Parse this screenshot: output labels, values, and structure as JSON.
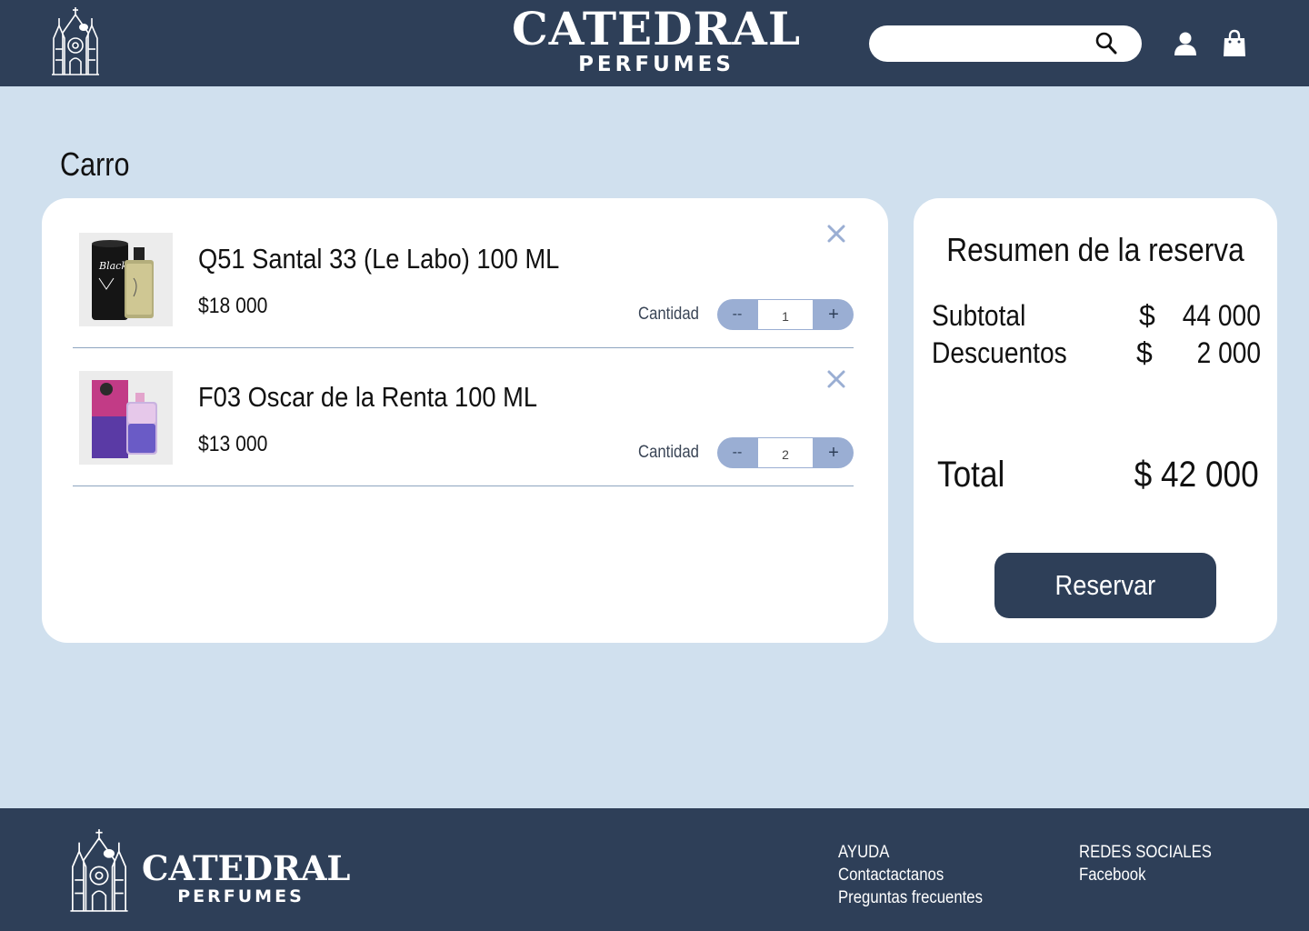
{
  "header": {
    "brand_main": "CATEDRAL",
    "brand_sub": "PERFUMES",
    "search_placeholder": "",
    "icons": [
      "cathedral-logo-icon",
      "search-icon",
      "user-icon",
      "shopping-bag-icon"
    ]
  },
  "page": {
    "title": "Carro"
  },
  "cart": {
    "quantity_label": "Cantidad",
    "minus_label": "--",
    "plus_label": "+",
    "items": [
      {
        "name": "Q51 Santal 33 (Le Labo) 100 ML",
        "price": "$18 000",
        "quantity": "1"
      },
      {
        "name": "F03 Oscar de la Renta 100 ML",
        "price": "$13 000",
        "quantity": "2"
      }
    ]
  },
  "summary": {
    "title": "Resumen de la reserva",
    "subtotal_label": "Subtotal",
    "subtotal_currency": "$",
    "subtotal_value": "44 000",
    "discount_label": "Descuentos",
    "discount_currency": "$",
    "discount_value": "2 000",
    "total_label": "Total",
    "total_value": "$ 42 000",
    "reserve_button": "Reservar"
  },
  "footer": {
    "brand_main": "CATEDRAL",
    "brand_sub": "PERFUMES",
    "help_title": "AYUDA",
    "help_links": [
      "Contactactanos",
      "Preguntas frecuentes"
    ],
    "social_title": "REDES SOCIALES",
    "social_links": [
      "Facebook"
    ]
  },
  "colors": {
    "navy": "#2e3f58",
    "background": "#d0e0ee",
    "stepper": "#9aaed3",
    "remove_icon": "#9aaed3"
  }
}
